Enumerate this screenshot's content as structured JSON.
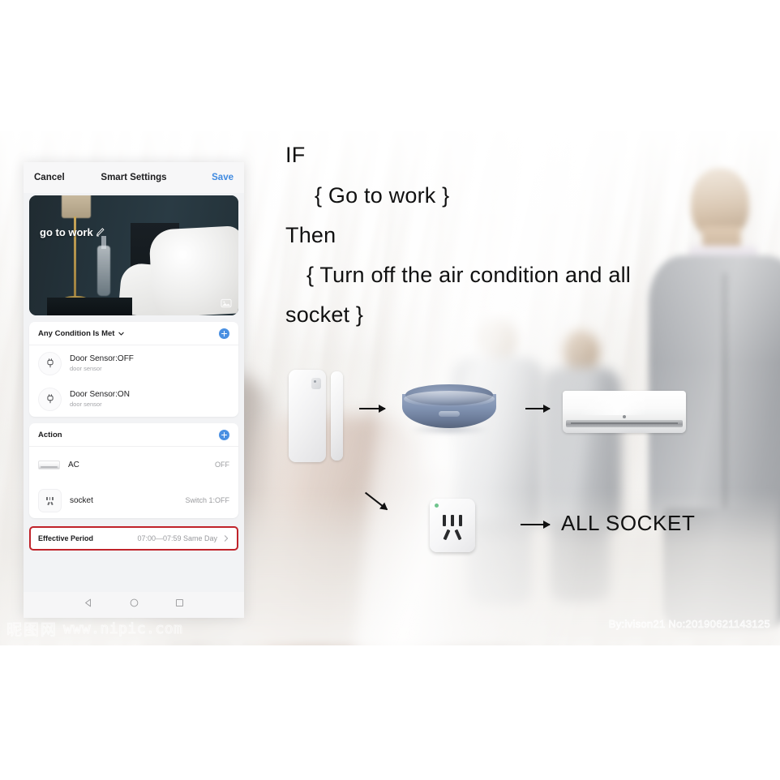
{
  "phone": {
    "nav": {
      "cancel_label": "Cancel",
      "title": "Smart Settings",
      "save_label": "Save"
    },
    "hero": {
      "scene_name": "go to work",
      "edit_icon": "pencil-icon",
      "image_badge_icon": "image-icon"
    },
    "condition_section": {
      "header_label": "Any Condition Is Met",
      "dropdown_icon": "chevron-down-icon",
      "add_icon": "plus-circle-icon",
      "items": [
        {
          "icon": "plug-icon",
          "title": "Door Sensor:OFF",
          "subtitle": "door sensor"
        },
        {
          "icon": "plug-icon",
          "title": "Door Sensor:ON",
          "subtitle": "door sensor"
        }
      ]
    },
    "action_section": {
      "header_label": "Action",
      "add_icon": "plus-circle-icon",
      "items": [
        {
          "icon": "air-conditioner-icon",
          "title": "AC",
          "state": "OFF"
        },
        {
          "icon": "socket-icon",
          "title": "socket",
          "state": "Switch 1:OFF"
        }
      ]
    },
    "effective_period": {
      "label": "Effective Period",
      "value": "07:00—07:59 Same Day",
      "chevron_icon": "chevron-right-icon",
      "highlight_color": "#c0232a"
    },
    "android_nav": {
      "back_icon": "triangle-back-icon",
      "home_icon": "circle-home-icon",
      "recents_icon": "square-recents-icon"
    },
    "accent_color": "#4a90e2",
    "save_color": "#3f8ae0"
  },
  "annotation": {
    "if_label": "IF",
    "condition_text": "{ Go to work }",
    "then_label": "Then",
    "action_line1": "{ Turn off the air condition and all",
    "action_line2": "socket }",
    "all_socket_label": "ALL SOCKET"
  },
  "devices": {
    "door_sensor": "door-sensor-device",
    "ir_hub": "ir-hub-device",
    "air_conditioner": "air-conditioner-device",
    "smart_socket": "smart-socket-device"
  },
  "arrows": {
    "door_to_hub": "arrow-right-icon",
    "hub_to_ac": "arrow-right-icon",
    "door_to_socket": "arrow-diagonal-icon",
    "socket_to_label": "arrow-right-icon"
  },
  "watermark": {
    "site_cn": "昵图网",
    "site_url": "www.nipic.com",
    "credit": "By:ivison21 No:20190621143125"
  }
}
